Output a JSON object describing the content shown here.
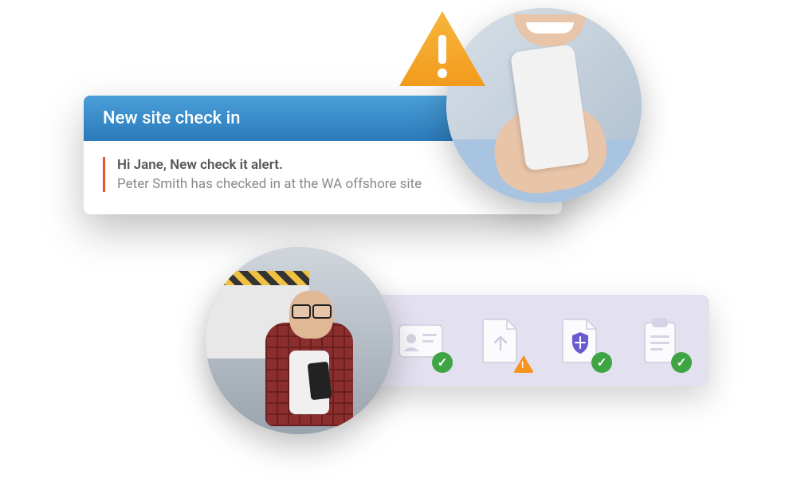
{
  "notification": {
    "title": "New site check in",
    "line1": "Hi Jane, New check it alert.",
    "line2": "Peter Smith has checked in at the WA offshore site"
  },
  "alert": {
    "type": "warning"
  },
  "status_items": [
    {
      "icon": "id-card",
      "status": "ok"
    },
    {
      "icon": "upload",
      "status": "warn"
    },
    {
      "icon": "shield",
      "status": "ok"
    },
    {
      "icon": "clipboard",
      "status": "ok"
    }
  ],
  "colors": {
    "header_gradient_top": "#4a9fd8",
    "header_gradient_bottom": "#2b7abb",
    "accent_bar": "#e8562a",
    "status_bg": "#e3e0ef",
    "ok": "#3fa544",
    "warn": "#f5941f",
    "alert_triangle_top": "#f6b73c",
    "alert_triangle_bottom": "#f29b1d"
  }
}
